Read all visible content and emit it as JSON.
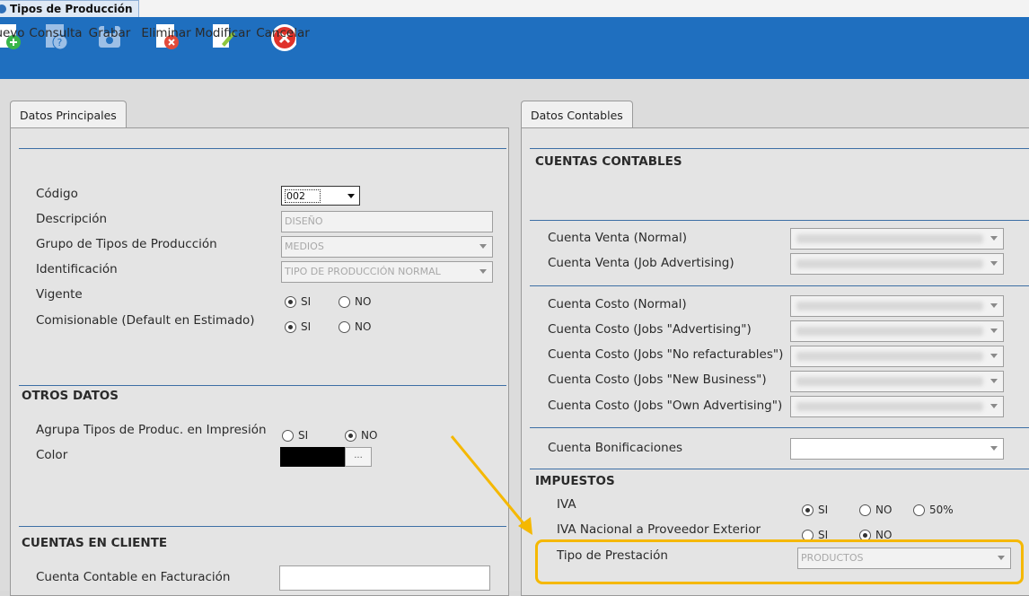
{
  "window_title": "Tipos de Producción",
  "toolbar": {
    "nuevo": "uevo",
    "consulta": "Consulta",
    "grabar": "Grabar",
    "eliminar": "Eliminar",
    "modificar": "Modificar",
    "cancelar": "Cancelar"
  },
  "left": {
    "tab": "Datos Principales",
    "codigo_label": "Código",
    "codigo_value": "002",
    "descripcion_label": "Descripción",
    "descripcion_value": "DISEÑO",
    "grupo_label": "Grupo de Tipos de Producción",
    "grupo_value": "MEDIOS",
    "identificacion_label": "Identificación",
    "identificacion_value": "TIPO DE PRODUCCIÓN NORMAL",
    "vigente_label": "Vigente",
    "comisionable_label": "Comisionable (Default en Estimado)",
    "otros_datos": "OTROS DATOS",
    "agrupa_label": "Agrupa Tipos de Produc. en Impresión",
    "color_label": "Color",
    "color_button": "...",
    "cuentas_cliente": "CUENTAS EN CLIENTE",
    "cuenta_facturacion_label": "Cuenta Contable en Facturación"
  },
  "right": {
    "tab": "Datos Contables",
    "cuentas_contables": "CUENTAS CONTABLES",
    "venta_normal": "Cuenta Venta (Normal)",
    "venta_job": "Cuenta Venta (Job Advertising)",
    "costo_normal": "Cuenta Costo (Normal)",
    "costo_adv": "Cuenta Costo (Jobs \"Advertising\")",
    "costo_norefac": "Cuenta Costo (Jobs \"No refacturables\")",
    "costo_newbiz": "Cuenta Costo (Jobs \"New Business\")",
    "costo_own": "Cuenta Costo (Jobs \"Own Advertising\")",
    "bonificaciones": "Cuenta Bonificaciones",
    "impuestos": "IMPUESTOS",
    "iva": "IVA",
    "iva_nacional": "IVA Nacional a Proveedor Exterior",
    "tipo_prestacion": "Tipo de Prestación",
    "tipo_prestacion_value": "PRODUCTOS"
  },
  "radio": {
    "si": "SI",
    "no": "NO",
    "p50": "50%"
  },
  "colors": {
    "toolbar": "#1f6fbf",
    "highlight": "#f5b800",
    "separator": "#3d6fa5",
    "color_swatch": "#000000"
  }
}
